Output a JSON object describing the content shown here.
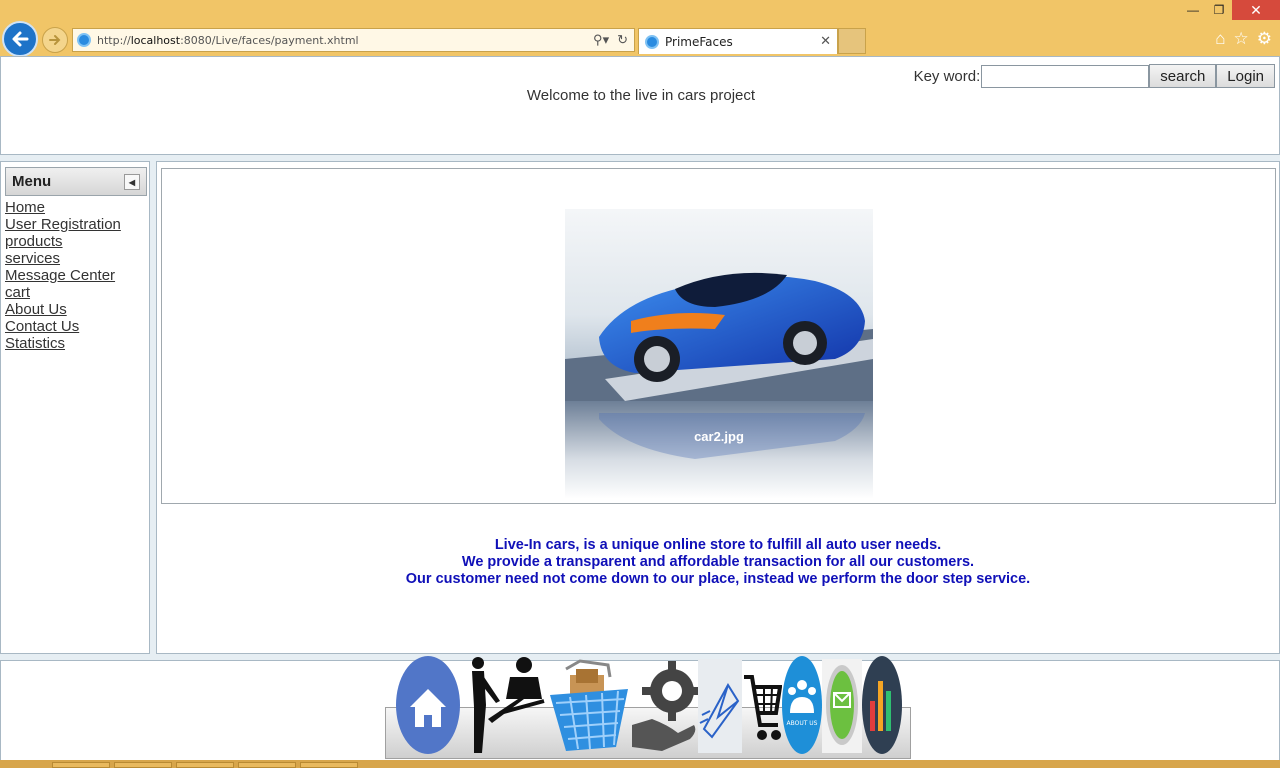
{
  "browser": {
    "url_prefix": "http://",
    "url_host": "localhost",
    "url_rest": ":8080/Live/faces/payment.xhtml",
    "tab_title": "PrimeFaces",
    "icons": [
      "back-arrow-icon",
      "forward-arrow-icon",
      "search-icon",
      "refresh-icon",
      "home-icon",
      "star-icon",
      "gear-icon"
    ]
  },
  "header": {
    "welcome": "Welcome to the live in cars project",
    "keyword_label": "Key word:",
    "search_value": "",
    "search_button": "search",
    "login_button": "Login"
  },
  "menu": {
    "title": "Menu",
    "items": [
      {
        "label": "Home"
      },
      {
        "label": "User Registration"
      },
      {
        "label": "products"
      },
      {
        "label": "services"
      },
      {
        "label": "Message Center"
      },
      {
        "label": "cart"
      },
      {
        "label": "About Us"
      },
      {
        "label": "Contact Us"
      },
      {
        "label": "Statistics"
      }
    ]
  },
  "gallery": {
    "caption": "car2.jpg"
  },
  "tagline": {
    "line1": "Live-In cars, is a unique online store to fulfill all auto user needs.",
    "line2": "We provide a transparent and affordable transaction for all our customers.",
    "line3": "Our customer need not come down to our place, instead we perform the door step service."
  },
  "dock": {
    "items": [
      "home-icon",
      "registration-icon",
      "products-basket-icon",
      "services-gear-hand-icon",
      "message-envelope-icon",
      "cart-icon",
      "about-us-icon",
      "contact-icon",
      "statistics-icon"
    ]
  },
  "colors": {
    "chrome": "#f1c567",
    "tagline": "#1010b8",
    "close": "#d64a3c"
  }
}
